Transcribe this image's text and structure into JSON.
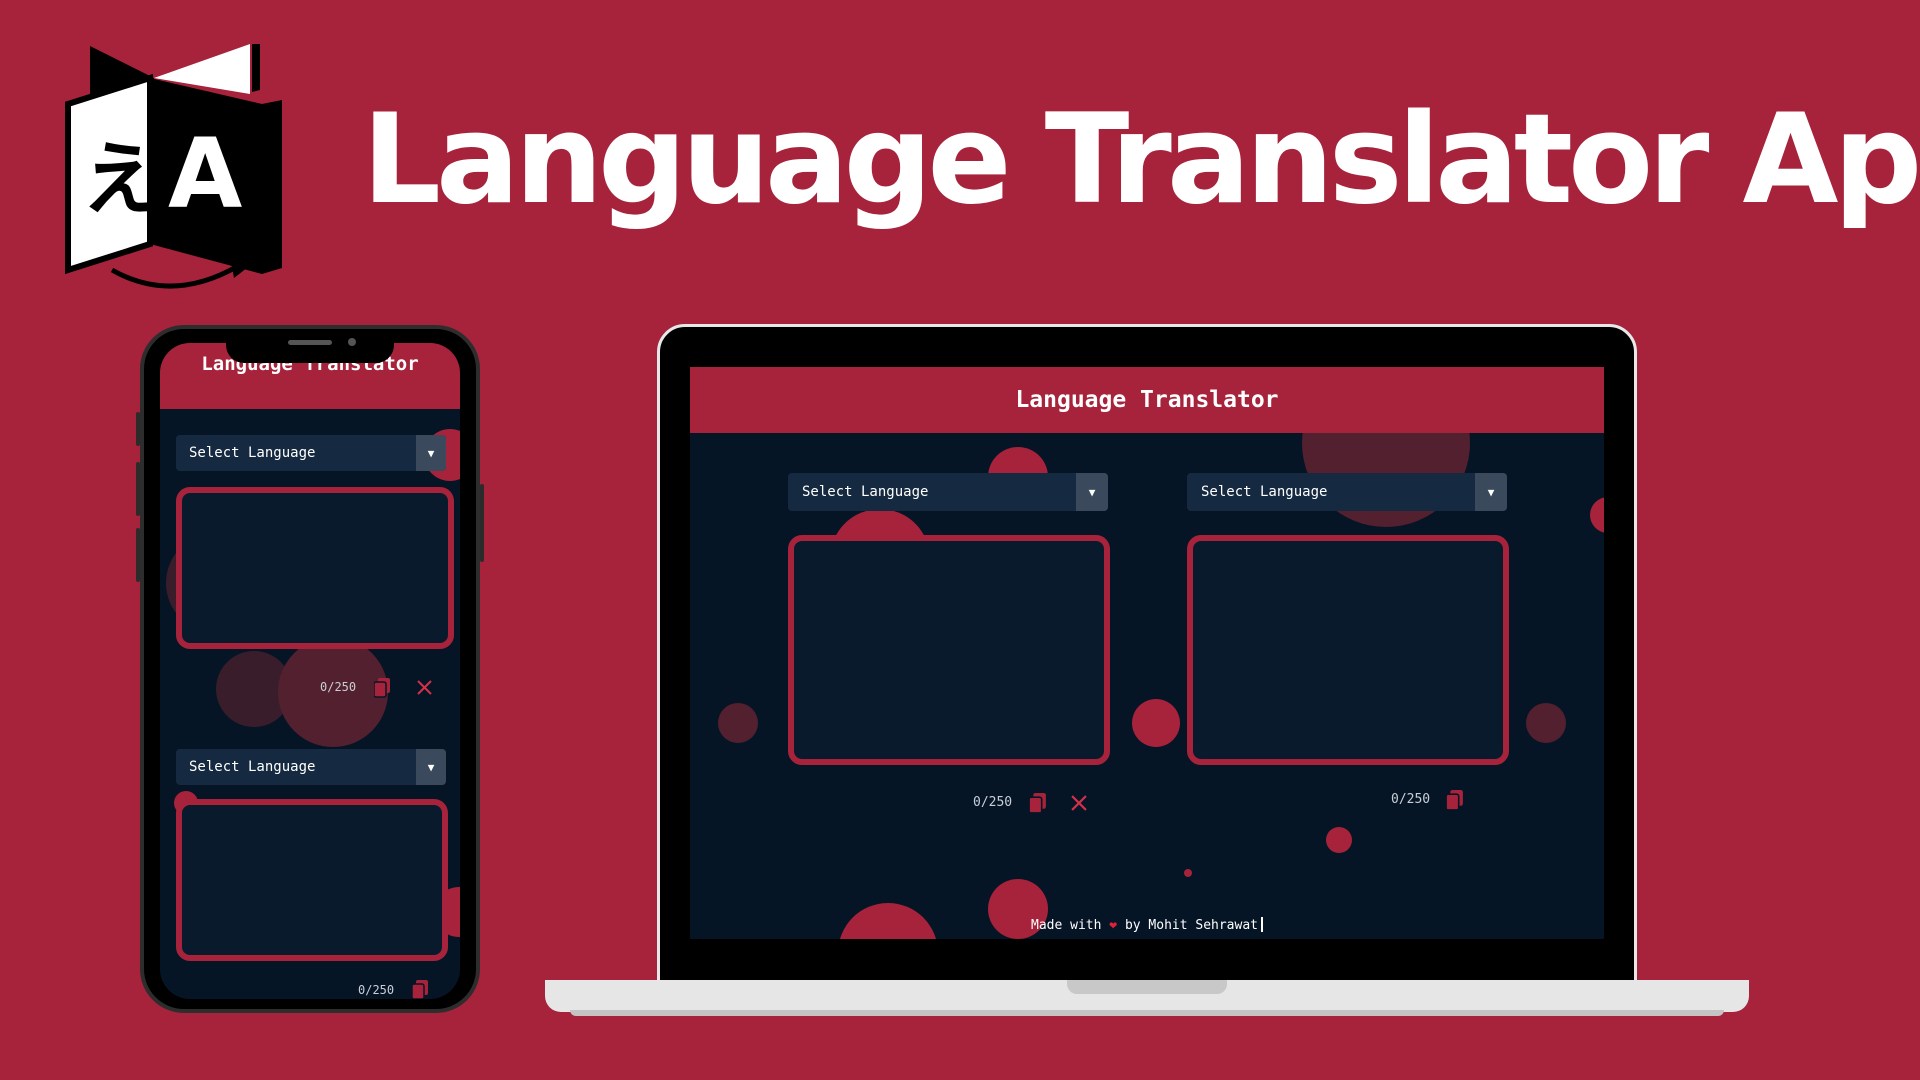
{
  "banner": {
    "title": "Language Translator App",
    "logo": {
      "icon": "translate-book-icon",
      "left_glyph": "え",
      "right_glyph": "A"
    }
  },
  "colors": {
    "background": "#a6233b",
    "app_background": "#061526",
    "accent": "#a6233b",
    "white": "#ffffff"
  },
  "phone_app": {
    "header_title": "Language Translator",
    "source": {
      "select_label": "Select Language",
      "counter": "0/250",
      "copy_icon": "copy-icon",
      "clear_icon": "close-icon"
    },
    "target": {
      "select_label": "Select Language",
      "counter": "0/250",
      "copy_icon": "copy-icon"
    }
  },
  "laptop_app": {
    "header_title": "Language Translator",
    "source": {
      "select_label": "Select Language",
      "counter": "0/250",
      "copy_icon": "copy-icon",
      "clear_icon": "close-icon"
    },
    "target": {
      "select_label": "Select Language",
      "counter": "0/250",
      "copy_icon": "copy-icon"
    },
    "footer": {
      "prefix": "Made with",
      "heart": "❤",
      "suffix": "by Mohit Sehrawat"
    }
  }
}
